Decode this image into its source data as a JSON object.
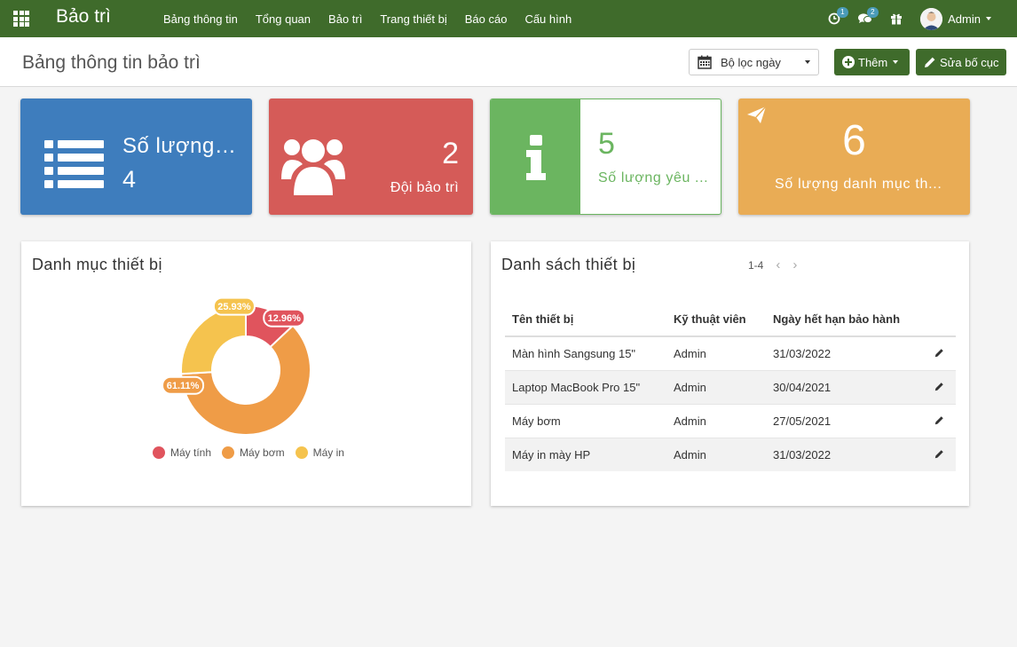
{
  "nav": {
    "app_name": "Bảo trì",
    "menu": [
      "Bảng thông tin",
      "Tổng quan",
      "Bảo trì",
      "Trang thiết bị",
      "Báo cáo",
      "Cấu hình"
    ],
    "activity_count": "1",
    "message_count": "2",
    "user_name": "Admin"
  },
  "control": {
    "page_title": "Bảng thông tin bảo trì",
    "date_filter_label": "Bộ lọc ngày",
    "add_label": "Thêm",
    "edit_layout_label": "Sửa bố cục"
  },
  "tiles": [
    {
      "label": "Số lượng ...",
      "value": "4",
      "color": "#3e7dbd",
      "icon": "list-icon"
    },
    {
      "label": "Đội bảo trì",
      "value": "2",
      "color": "#d55b58",
      "icon": "users-icon"
    },
    {
      "label": "Số lượng yêu ...",
      "value": "5",
      "color": "#6bb560",
      "icon": "info-icon"
    },
    {
      "label": "Số lượng danh mục th...",
      "value": "6",
      "color": "#e9ac55",
      "icon": "paper-plane-icon"
    }
  ],
  "chart_panel": {
    "title": "Danh mục thiết bị"
  },
  "chart_data": {
    "type": "pie",
    "donut": true,
    "categories": [
      "Máy tính",
      "Máy bơm",
      "Máy in"
    ],
    "values": [
      12.96,
      61.11,
      25.93
    ],
    "labels": [
      "12.96%",
      "61.11%",
      "25.93%"
    ],
    "colors": [
      "#e0545d",
      "#ef9c47",
      "#f5c34e"
    ],
    "legend": "bottom"
  },
  "list_panel": {
    "title": "Danh sách thiết bị",
    "pager": "1-4",
    "columns": [
      "Tên thiết bị",
      "Kỹ thuật viên",
      "Ngày hết hạn bảo hành"
    ],
    "rows": [
      [
        "Màn hình Sangsung 15\"",
        "Admin",
        "31/03/2022"
      ],
      [
        "Laptop MacBook Pro 15\"",
        "Admin",
        "30/04/2021"
      ],
      [
        "Máy bơm",
        "Admin",
        "27/05/2021"
      ],
      [
        "Máy in mày HP",
        "Admin",
        "31/03/2022"
      ]
    ]
  }
}
